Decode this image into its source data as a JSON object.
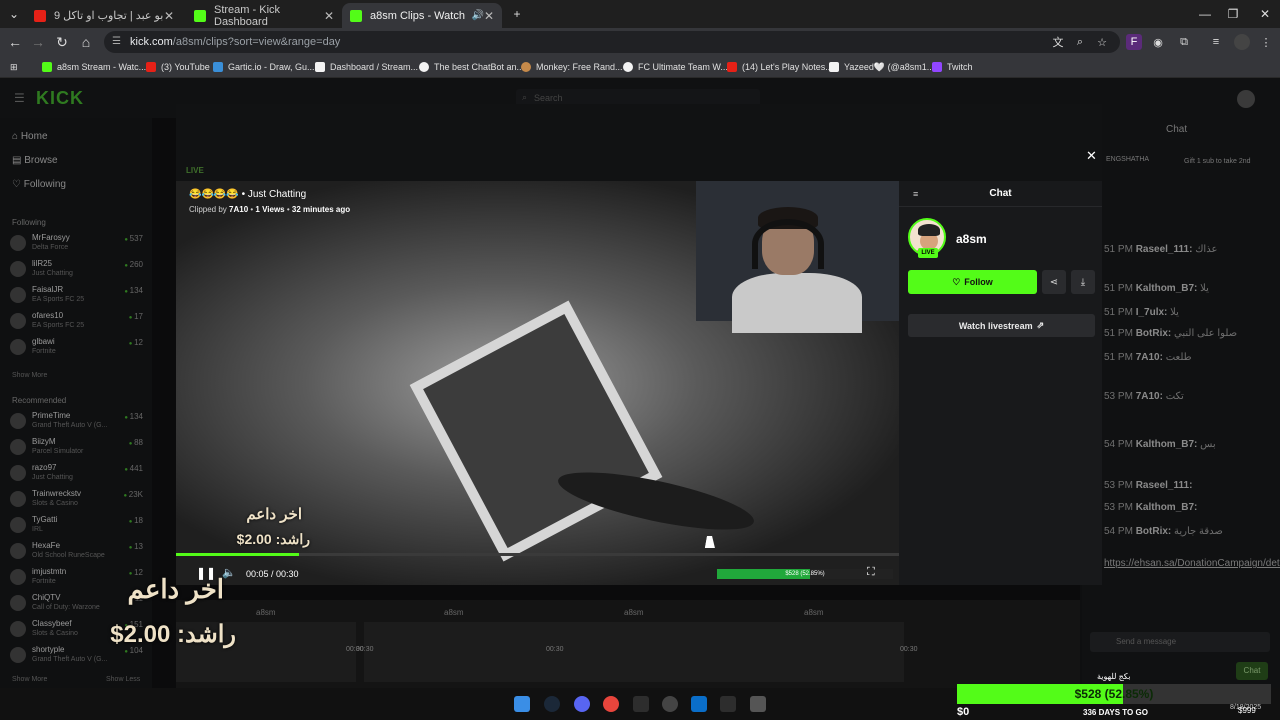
{
  "browser": {
    "tabs": [
      {
        "title": "مع ابو عبد | تجاوب او تاكل 9#",
        "favicon_color": "#e62117"
      },
      {
        "title": "Stream - Kick Dashboard",
        "favicon_color": "#53fc18"
      },
      {
        "title": "a8sm Clips - Watch Live on",
        "favicon_color": "#53fc18"
      }
    ],
    "url_host": "kick.com",
    "url_path": "/a8sm/clips?sort=view&range=day",
    "bookmarks": [
      {
        "label": "a8sm Stream - Watc...",
        "color": "#53fc18"
      },
      {
        "label": "(3) YouTube",
        "color": "#e62117"
      },
      {
        "label": "Gartic.io - Draw, Gu...",
        "color": "#3a8fd8"
      },
      {
        "label": "Dashboard / Stream...",
        "color": "#f3f3f3"
      },
      {
        "label": "The best ChatBot an...",
        "color": "#f3f3f3"
      },
      {
        "label": "Monkey: Free Rand...",
        "color": "#c68a4a"
      },
      {
        "label": "FC Ultimate Team W...",
        "color": "#f3f3f3"
      },
      {
        "label": "(14) Let's Play Notes...",
        "color": "#e62117"
      },
      {
        "label": "Yazeed🤍 (@a8sm1...",
        "color": "#f3f3f3"
      },
      {
        "label": "Twitch",
        "color": "#9146ff"
      }
    ]
  },
  "kick": {
    "logo": "KICK",
    "search_placeholder": "Search",
    "nav": [
      "Home",
      "Browse",
      "Following"
    ],
    "following_heading": "Following",
    "following": [
      {
        "name": "MrFarosyy",
        "category": "Delta Force",
        "viewers": "537"
      },
      {
        "name": "lilR25",
        "category": "Just Chatting",
        "viewers": "260"
      },
      {
        "name": "FaisalJR",
        "category": "EA Sports FC 25",
        "viewers": "134"
      },
      {
        "name": "ofares10",
        "category": "EA Sports FC 25",
        "viewers": "17"
      },
      {
        "name": "glbawi",
        "category": "Fortnite",
        "viewers": "12"
      }
    ],
    "show_more": "Show More",
    "recommended_heading": "Recommended",
    "recommended": [
      {
        "name": "PrimeTime",
        "category": "Grand Theft Auto V (G...",
        "viewers": "134"
      },
      {
        "name": "BiizyM",
        "category": "Parcel Simulator",
        "viewers": "88"
      },
      {
        "name": "razo97",
        "category": "Just Chatting",
        "viewers": "441"
      },
      {
        "name": "Trainwreckstv",
        "category": "Slots & Casino",
        "viewers": "23K"
      },
      {
        "name": "TyGatti",
        "category": "IRL",
        "viewers": "18"
      },
      {
        "name": "HexaFe",
        "category": "Old School RuneScape",
        "viewers": "13"
      },
      {
        "name": "imjustmtn",
        "category": "Fortnite",
        "viewers": "12"
      },
      {
        "name": "ChiQTV",
        "category": "Call of Duty: Warzone",
        "viewers": "11"
      },
      {
        "name": "Classybeef",
        "category": "Slots & Casino",
        "viewers": "151"
      },
      {
        "name": "shortyple",
        "category": "Grand Theft Auto V (G...",
        "viewers": "104"
      }
    ],
    "show_less": "Show Less",
    "right_chat_title": "Chat",
    "pinned": {
      "user": "ENGSHATHA",
      "text": "Gift 1 sub to take 2nd"
    },
    "chat_lines": [
      {
        "time": "51 PM",
        "user": "Raseel_111:",
        "msg": "عذاك"
      },
      {
        "time": "51 PM",
        "user": "Kalthom_B7:",
        "msg": "يلا"
      },
      {
        "time": "51 PM",
        "user": "I_7ulx:",
        "msg": "يلا"
      },
      {
        "time": "51 PM",
        "user": "BotRix:",
        "msg": "صلوا على النبي"
      },
      {
        "time": "51 PM",
        "user": "7A10:",
        "msg": "طلعت"
      },
      {
        "time": "53 PM",
        "user": "7A10:",
        "msg": "تكت"
      },
      {
        "time": "54 PM",
        "user": "Kalthom_B7:",
        "msg": "بس"
      },
      {
        "time": "53 PM",
        "user": "Raseel_111:",
        "msg": ""
      },
      {
        "time": "53 PM",
        "user": "Kalthom_B7:",
        "msg": ""
      },
      {
        "time": "54 PM",
        "user": "BotRix:",
        "msg": "صدقة جارية"
      }
    ],
    "donation_link": "https://ehsan.sa/DonationCampaign/details/1549155",
    "send_placeholder": "Send a message",
    "chat_button": "Chat"
  },
  "clip": {
    "live_label": "LIVE",
    "title": "😂😂😂😂 • Just Chatting",
    "clipped_by_label": "Clipped by",
    "clipper": "7A10",
    "views": "1 Views",
    "ago": "32 minutes ago",
    "overlay_line1": "اخر داعم",
    "overlay_line2": "راشد: 2.00$",
    "time": "00:05 / 00:30",
    "progress": 0.17,
    "mini_donation_text": "$528 (52.85%)",
    "mini_donation_pct": 0.5285,
    "panel_title": "Chat",
    "channel": "a8sm",
    "live_badge": "LIVE",
    "follow": "Follow",
    "watch_livestream": "Watch livestream"
  },
  "thumbs": [
    {
      "label": "a8sm",
      "duration": "00:30"
    },
    {
      "label": "a8sm",
      "duration": "00:30"
    },
    {
      "label": "a8sm",
      "duration": "00:30"
    },
    {
      "label": "a8sm",
      "duration": "00:30"
    }
  ],
  "donation_widget": {
    "title": "بكج للهوية",
    "amount_text": "$528 (52.85%)",
    "pct": 0.5285,
    "min": "$0",
    "days": "336 DAYS TO GO",
    "max": "$999",
    "date": "8/18/2025"
  }
}
